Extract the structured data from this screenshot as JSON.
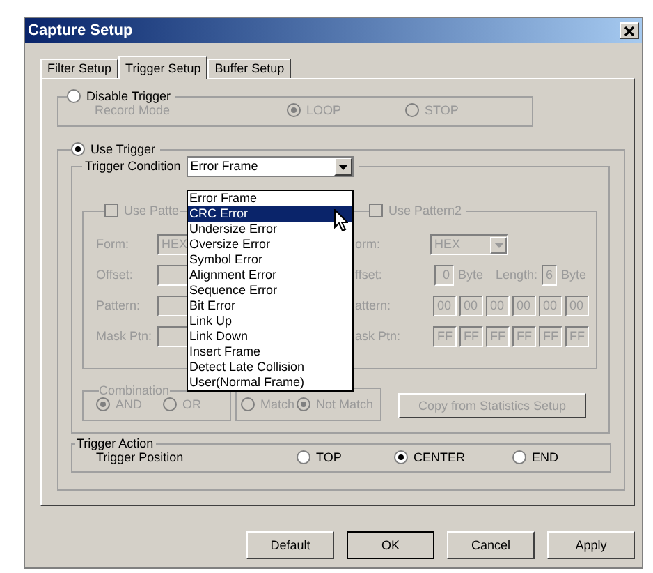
{
  "window": {
    "title": "Capture Setup"
  },
  "tabs": [
    {
      "label": "Filter Setup",
      "selected": false
    },
    {
      "label": "Trigger Setup",
      "selected": true
    },
    {
      "label": "Buffer Setup",
      "selected": false
    }
  ],
  "disable_trigger": {
    "label": "Disable Trigger",
    "selected": false,
    "record_mode_label": "Record Mode",
    "disabled": true,
    "options": [
      {
        "label": "LOOP",
        "selected": true
      },
      {
        "label": "STOP",
        "selected": false
      }
    ]
  },
  "use_trigger": {
    "label": "Use Trigger",
    "selected": true
  },
  "trigger_condition": {
    "label": "Trigger Condition",
    "value": "Error Frame",
    "expanded": true,
    "options": [
      {
        "label": "Error Frame",
        "highlighted": false
      },
      {
        "label": "CRC Error",
        "highlighted": true
      },
      {
        "label": "Undersize Error",
        "highlighted": false
      },
      {
        "label": "Oversize Error",
        "highlighted": false
      },
      {
        "label": "Symbol Error",
        "highlighted": false
      },
      {
        "label": "Alignment Error",
        "highlighted": false
      },
      {
        "label": "Sequence Error",
        "highlighted": false
      },
      {
        "label": "Bit Error",
        "highlighted": false
      },
      {
        "label": "Link Up",
        "highlighted": false
      },
      {
        "label": "Link Down",
        "highlighted": false
      },
      {
        "label": "Insert Frame",
        "highlighted": false
      },
      {
        "label": "Detect Late Collision",
        "highlighted": false
      },
      {
        "label": "User(Normal Frame)",
        "highlighted": false
      }
    ]
  },
  "pattern1": {
    "label": "Use Patte",
    "checked": false,
    "disabled": true,
    "form_label": "Form:",
    "form_value": "HEX",
    "offset_label": "Offset:",
    "pattern_label": "Pattern:",
    "mask_label": "Mask Ptn:"
  },
  "pattern2": {
    "label": "Use Pattern2",
    "checked": false,
    "disabled": true,
    "form_label": "orm:",
    "form_value": "HEX",
    "offset_label": "ffset:",
    "offset_value": "0",
    "offset_unit": "Byte",
    "length_label": "Length:",
    "length_value": "6",
    "length_unit": "Byte",
    "pattern_label": "attern:",
    "pattern": [
      "00",
      "00",
      "00",
      "00",
      "00",
      "00"
    ],
    "mask_label": "ask Ptn:",
    "mask": [
      "FF",
      "FF",
      "FF",
      "FF",
      "FF",
      "FF"
    ]
  },
  "combination": {
    "label": "Combination",
    "disabled": true,
    "options": [
      {
        "label": "AND",
        "selected": true
      },
      {
        "label": "OR",
        "selected": false
      }
    ]
  },
  "match": {
    "disabled": true,
    "options": [
      {
        "label": "Match",
        "selected": false
      },
      {
        "label": "Not Match",
        "selected": true
      }
    ]
  },
  "copy_button": {
    "label": "Copy from Statistics Setup",
    "disabled": true
  },
  "trigger_action": {
    "label": "Trigger Action",
    "position_label": "Trigger Position",
    "options": [
      {
        "label": "TOP",
        "selected": false
      },
      {
        "label": "CENTER",
        "selected": true
      },
      {
        "label": "END",
        "selected": false
      }
    ]
  },
  "buttons": [
    "Default",
    "OK",
    "Cancel",
    "Apply"
  ]
}
